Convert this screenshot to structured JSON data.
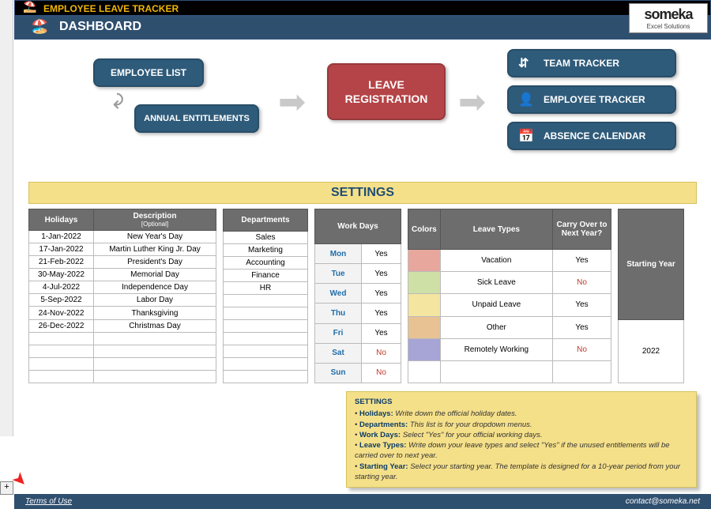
{
  "header": {
    "app": "EMPLOYEE LEAVE TRACKER",
    "page": "DASHBOARD"
  },
  "logo": {
    "brand": "someka",
    "tag": "Excel Solutions"
  },
  "nav": {
    "employee_list": "EMPLOYEE LIST",
    "annual_entitlements": "ANNUAL ENTITLEMENTS",
    "leave_registration": "LEAVE REGISTRATION",
    "team_tracker": "TEAM TRACKER",
    "employee_tracker": "EMPLOYEE TRACKER",
    "absence_calendar": "ABSENCE CALENDAR"
  },
  "settings_title": "SETTINGS",
  "headers": {
    "holidays": "Holidays",
    "desc": "Description",
    "desc_sub": "[Optional]",
    "departments": "Departments",
    "workdays": "Work Days",
    "colors": "Colors",
    "leave_types": "Leave Types",
    "carry": "Carry Over to Next Year?",
    "starting_year": "Starting Year"
  },
  "holidays": [
    {
      "date": "1-Jan-2022",
      "desc": "New Year's Day"
    },
    {
      "date": "17-Jan-2022",
      "desc": "Martin Luther King Jr. Day"
    },
    {
      "date": "21-Feb-2022",
      "desc": "President's Day"
    },
    {
      "date": "30-May-2022",
      "desc": "Memorial Day"
    },
    {
      "date": "4-Jul-2022",
      "desc": "Independence Day"
    },
    {
      "date": "5-Sep-2022",
      "desc": "Labor Day"
    },
    {
      "date": "24-Nov-2022",
      "desc": "Thanksgiving"
    },
    {
      "date": "26-Dec-2022",
      "desc": "Christmas Day"
    }
  ],
  "departments": [
    "Sales",
    "Marketing",
    "Accounting",
    "Finance",
    "HR"
  ],
  "workdays": [
    {
      "d": "Mon",
      "v": "Yes"
    },
    {
      "d": "Tue",
      "v": "Yes"
    },
    {
      "d": "Wed",
      "v": "Yes"
    },
    {
      "d": "Thu",
      "v": "Yes"
    },
    {
      "d": "Fri",
      "v": "Yes"
    },
    {
      "d": "Sat",
      "v": "No"
    },
    {
      "d": "Sun",
      "v": "No"
    }
  ],
  "leave_types": [
    {
      "name": "Vacation",
      "carry": "Yes"
    },
    {
      "name": "Sick Leave",
      "carry": "No"
    },
    {
      "name": "Unpaid Leave",
      "carry": "Yes"
    },
    {
      "name": "Other",
      "carry": "Yes"
    },
    {
      "name": "Remotely Working",
      "carry": "No"
    }
  ],
  "starting_year": "2022",
  "help": {
    "title": "SETTINGS",
    "l1a": "Holidays:",
    "l1b": " Write down the official holiday dates.",
    "l2a": "Departments:",
    "l2b": " This list is for your dropdown menus.",
    "l3a": "Work Days:",
    "l3b": " Select \"Yes\" for your official working days.",
    "l4a": "Leave Types:",
    "l4b": " Write down your leave types and select \"Yes\" if the unused entitlements will be carried over to next year.",
    "l5a": "Starting Year:",
    "l5b": " Select your starting year. The template is designed for a 10-year period from your starting year."
  },
  "footer": {
    "terms": "Terms of Use",
    "contact": "contact@someka.net"
  }
}
